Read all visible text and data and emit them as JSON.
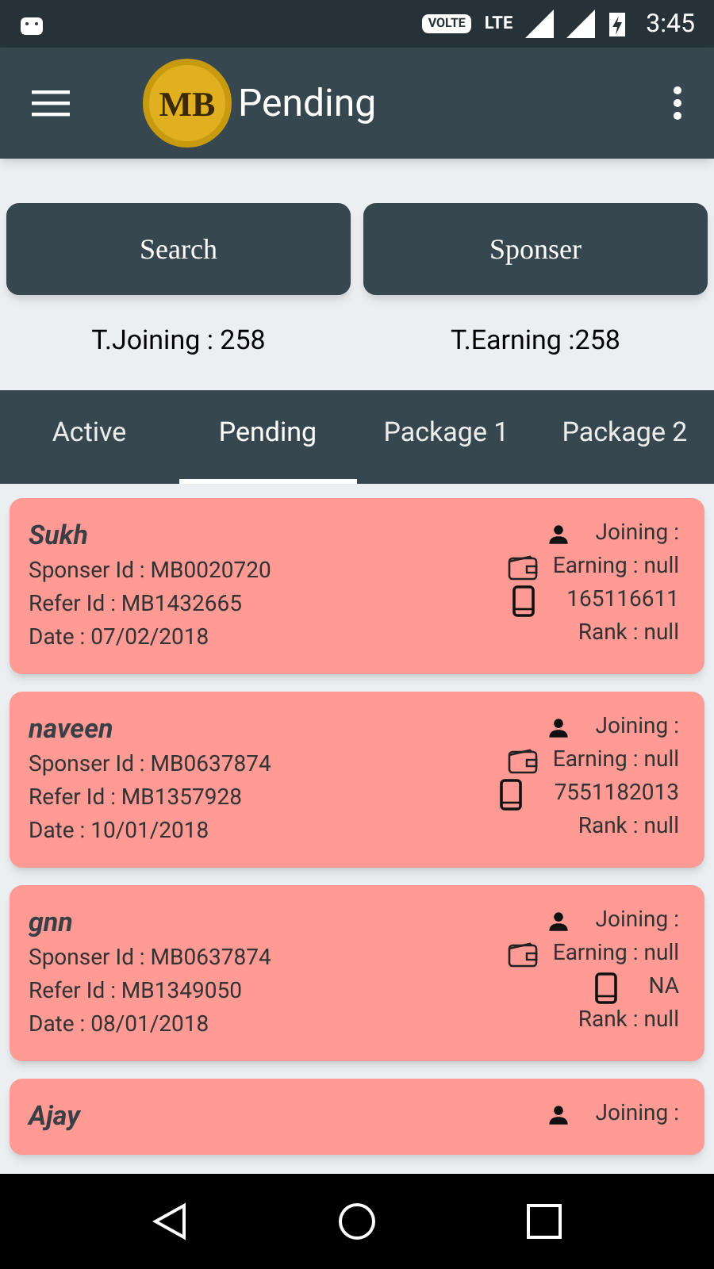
{
  "status_bar": {
    "network_badge": "VOLTE",
    "network_type": "LTE",
    "time": "3:45"
  },
  "app_bar": {
    "logo": "MB",
    "title": "Pending"
  },
  "buttons": [
    "Search",
    "Sponser"
  ],
  "totals": {
    "joining": "T.Joining : 258",
    "earning": "T.Earning :258"
  },
  "tabs": [
    {
      "label": "Active",
      "selected": false
    },
    {
      "label": "Pending",
      "selected": true
    },
    {
      "label": "Package 1",
      "selected": false
    },
    {
      "label": "Package 2",
      "selected": false
    }
  ],
  "members": [
    {
      "name": "Sukh",
      "sponser": "Sponser Id : MB0020720",
      "refer": "Refer Id : MB1432665",
      "date": "Date : 07/02/2018",
      "joining": "Joining :",
      "earning": "Earning : null",
      "phone": "165116611",
      "rank": "Rank : null"
    },
    {
      "name": "naveen",
      "sponser": "Sponser Id : MB0637874",
      "refer": "Refer Id : MB1357928",
      "date": "Date : 10/01/2018",
      "joining": "Joining :",
      "earning": "Earning : null",
      "phone": "7551182013",
      "rank": "Rank : null"
    },
    {
      "name": "gnn",
      "sponser": "Sponser Id : MB0637874",
      "refer": "Refer Id : MB1349050",
      "date": "Date : 08/01/2018",
      "joining": "Joining :",
      "earning": "Earning : null",
      "phone": "NA",
      "rank": "Rank : null"
    },
    {
      "name": "Ajay",
      "joining": "Joining :"
    }
  ]
}
